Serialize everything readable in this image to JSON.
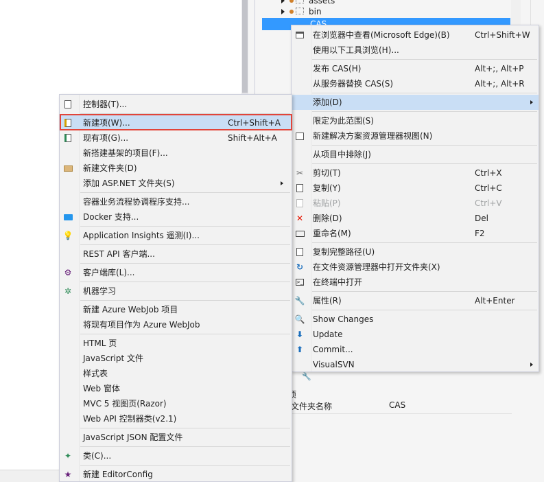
{
  "solution_tree": {
    "items": [
      {
        "label": "assets"
      },
      {
        "label": "bin"
      },
      {
        "label": "CAS"
      }
    ]
  },
  "properties": {
    "header": "项",
    "rows": [
      {
        "key": "文件夹名称",
        "value": "CAS"
      }
    ]
  },
  "context_menu": {
    "items": [
      {
        "label": "在浏览器中查看(Microsoft Edge)(B)",
        "shortcut": "Ctrl+Shift+W",
        "icon": "browser-icon"
      },
      {
        "label": "使用以下工具浏览(H)...",
        "shortcut": "",
        "icon": ""
      },
      {
        "label": "发布 CAS(H)",
        "shortcut": "Alt+;, Alt+P",
        "icon": ""
      },
      {
        "label": "从服务器替换 CAS(S)",
        "shortcut": "Alt+;, Alt+R",
        "icon": ""
      },
      {
        "label": "添加(D)",
        "shortcut": "",
        "icon": "",
        "submenu": true
      },
      {
        "label": "限定为此范围(S)",
        "shortcut": "",
        "icon": ""
      },
      {
        "label": "新建解决方案资源管理器视图(N)",
        "shortcut": "",
        "icon": "new-view-icon"
      },
      {
        "label": "从项目中排除(J)",
        "shortcut": "",
        "icon": ""
      },
      {
        "label": "剪切(T)",
        "shortcut": "Ctrl+X",
        "icon": "cut-icon"
      },
      {
        "label": "复制(Y)",
        "shortcut": "Ctrl+C",
        "icon": "copy-icon"
      },
      {
        "label": "粘贴(P)",
        "shortcut": "Ctrl+V",
        "icon": "paste-icon",
        "disabled": true
      },
      {
        "label": "删除(D)",
        "shortcut": "Del",
        "icon": "delete-icon"
      },
      {
        "label": "重命名(M)",
        "shortcut": "F2",
        "icon": "rename-icon"
      },
      {
        "label": "复制完整路径(U)",
        "shortcut": "",
        "icon": "copy-path-icon"
      },
      {
        "label": "在文件资源管理器中打开文件夹(X)",
        "shortcut": "",
        "icon": "open-folder-icon"
      },
      {
        "label": "在终端中打开",
        "shortcut": "",
        "icon": "terminal-icon"
      },
      {
        "label": "属性(R)",
        "shortcut": "Alt+Enter",
        "icon": "wrench-icon"
      },
      {
        "label": "Show Changes",
        "shortcut": "",
        "icon": "show-changes-icon"
      },
      {
        "label": "Update",
        "shortcut": "",
        "icon": "update-icon"
      },
      {
        "label": "Commit...",
        "shortcut": "",
        "icon": "commit-icon"
      },
      {
        "label": "VisualSVN",
        "shortcut": "",
        "icon": "",
        "submenu": true
      }
    ]
  },
  "add_submenu": {
    "items": [
      {
        "label": "控制器(T)...",
        "shortcut": "",
        "icon": "controller-icon"
      },
      {
        "label": "新建项(W)...",
        "shortcut": "Ctrl+Shift+A",
        "icon": "new-item-icon",
        "highlighted": true
      },
      {
        "label": "现有项(G)...",
        "shortcut": "Shift+Alt+A",
        "icon": "existing-item-icon"
      },
      {
        "label": "新搭建基架的项目(F)...",
        "shortcut": "",
        "icon": ""
      },
      {
        "label": "新建文件夹(D)",
        "shortcut": "",
        "icon": "new-folder-icon"
      },
      {
        "label": "添加 ASP.NET 文件夹(S)",
        "shortcut": "",
        "icon": "",
        "submenu": true
      },
      {
        "label": "容器业务流程协调程序支持...",
        "shortcut": "",
        "icon": ""
      },
      {
        "label": "Docker 支持...",
        "shortcut": "",
        "icon": "docker-icon"
      },
      {
        "label": "Application Insights 遥测(I)...",
        "shortcut": "",
        "icon": "app-insights-icon"
      },
      {
        "label": "REST API 客户端...",
        "shortcut": "",
        "icon": ""
      },
      {
        "label": "客户端库(L)...",
        "shortcut": "",
        "icon": "client-library-icon"
      },
      {
        "label": "机器学习",
        "shortcut": "",
        "icon": "machine-learning-icon"
      },
      {
        "label": "新建 Azure WebJob 项目",
        "shortcut": "",
        "icon": ""
      },
      {
        "label": "将现有项目作为 Azure WebJob",
        "shortcut": "",
        "icon": ""
      },
      {
        "label": "HTML 页",
        "shortcut": "",
        "icon": ""
      },
      {
        "label": "JavaScript 文件",
        "shortcut": "",
        "icon": ""
      },
      {
        "label": "样式表",
        "shortcut": "",
        "icon": ""
      },
      {
        "label": "Web 窗体",
        "shortcut": "",
        "icon": ""
      },
      {
        "label": "MVC 5 视图页(Razor)",
        "shortcut": "",
        "icon": ""
      },
      {
        "label": "Web API 控制器类(v2.1)",
        "shortcut": "",
        "icon": ""
      },
      {
        "label": "JavaScript JSON 配置文件",
        "shortcut": "",
        "icon": ""
      },
      {
        "label": "类(C)...",
        "shortcut": "",
        "icon": "class-icon"
      },
      {
        "label": "新建 EditorConfig",
        "shortcut": "",
        "icon": "editorconfig-icon"
      }
    ]
  }
}
